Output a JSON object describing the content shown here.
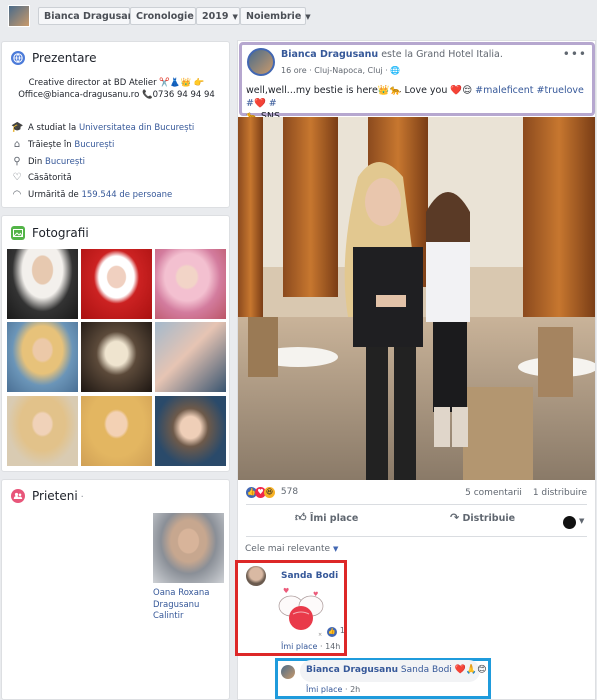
{
  "topbar": {
    "profile_name": "Bianca Dragusanu",
    "timeline_label": "Cronologie",
    "year_label": "2019",
    "month_label": "Noiembrie"
  },
  "intro": {
    "title": "Prezentare",
    "bio_line1": "Creative director at BD Atelier ✂️👗👑 👉",
    "bio_line2": "Office@bianca-dragusanu.ro 📞0736 94 94 94",
    "studied_prefix": "A studiat la",
    "studied_link": "Universitatea din București",
    "lives_prefix": "Trăiește în",
    "lives_link": "București",
    "from_prefix": "Din",
    "from_link": "București",
    "relationship": "Căsătorită",
    "followers_prefix": "Urmărită de",
    "followers_count": "159.544 de persoane"
  },
  "photos": {
    "title": "Fotografii"
  },
  "friends": {
    "title": "Prieteni",
    "dot": "·",
    "friend_name": "Oana Roxana Dragusanu Calintir"
  },
  "post": {
    "author": "Bianca Dragusanu",
    "location_text": "este la Grand Hotel Italia.",
    "time": "16 ore",
    "place": "Cluj-Napoca, Cluj",
    "text_prefix": "well,well...my bestie is here👑🐆 Love you ❤️😌",
    "hashtags": "#maleficent #truelove #❤️ #",
    "text_line2": "🐆 SNS",
    "reaction_count": "578",
    "comments_count": "5 comentarii",
    "shares_count": "1 distribuire",
    "like_label": "Îmi place",
    "share_label": "Distribuie",
    "sort_label": "Cele mai relevante"
  },
  "comments": [
    {
      "author": "Sanda Bodi",
      "like_count": "1",
      "like_label": "Îmi place",
      "time": "14h"
    },
    {
      "author": "Bianca Dragusanu",
      "mention": "Sanda Bodi",
      "text": "❤️🙏😊",
      "like_label": "Îmi place",
      "time": "2h"
    }
  ],
  "colors": {
    "link": "#365899",
    "facebook_blue": "#4267b2",
    "highlight_purple": "#b6a7cf",
    "highlight_red": "#dd2828",
    "highlight_blue": "#1f9bdc"
  }
}
